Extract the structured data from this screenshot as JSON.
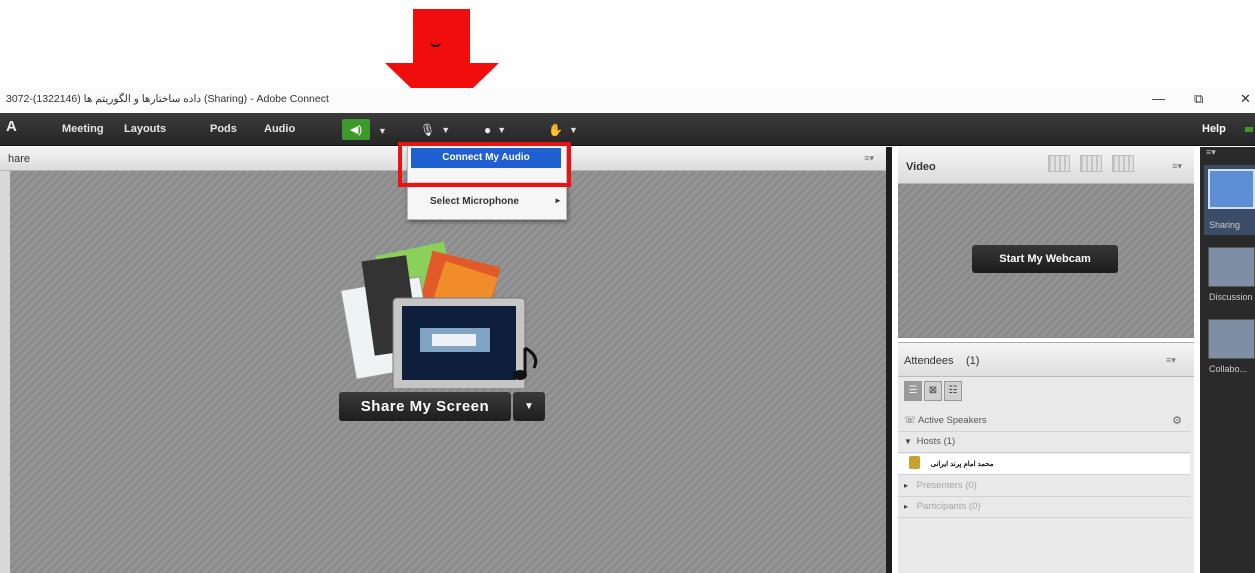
{
  "window": {
    "title": "3072-(1322146) داده ساختارها و الگوریتم ها (Sharing) - Adobe Connect",
    "minimize_glyph": "—",
    "restore_glyph": "⧉",
    "close_glyph": "✕"
  },
  "annotation": {
    "arrow_color": "#f20d0d",
    "highlight_color": "#ee1111"
  },
  "menubar": {
    "logo": "A",
    "items": [
      "Meeting",
      "Layouts",
      "Pods",
      "Audio"
    ],
    "help": "Help"
  },
  "share_pod": {
    "title": "hare",
    "share_button": "Share My Screen"
  },
  "mic_dropdown": {
    "highlighted_item": "Connect My Audio",
    "item": "Select Microphone",
    "item_arrow": "►"
  },
  "video_pod": {
    "title": "Video",
    "webcam_button": "Start My Webcam"
  },
  "attendees_pod": {
    "title": "Attendees",
    "count": "(1)",
    "active_speakers": "Active Speakers",
    "hosts": "Hosts (1)",
    "host_name": "محمد امام پرند ایرانی",
    "presenters": "Presenters (0)",
    "participants": "Participants (0)"
  },
  "layouts_panel": {
    "items": [
      "Sharing",
      "Discussion",
      "Collabo..."
    ]
  },
  "colors": {
    "accent_blue": "#1f5fd1",
    "audio_green": "#3d9a2a"
  }
}
